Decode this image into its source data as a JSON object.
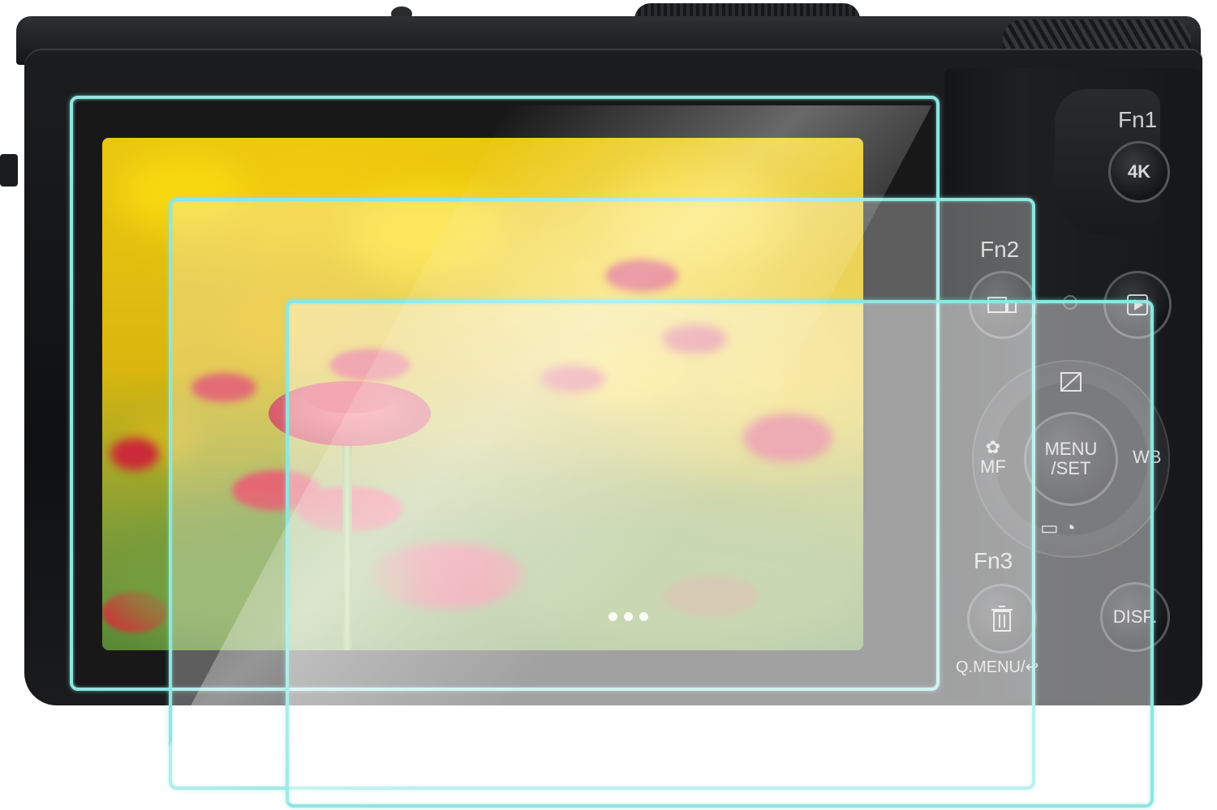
{
  "camera": {
    "buttons": {
      "fn1": "Fn1",
      "fn2": "Fn2",
      "fn3": "Fn3",
      "fourk": "4K",
      "menu_set_line1": "MENU",
      "menu_set_line2": "/SET",
      "mf": "MF",
      "wb": "WB",
      "disp": "DISP.",
      "qmenu": "Q.MENU/"
    },
    "icons": {
      "fourk": "4k-photo-icon",
      "playback": "playback-icon",
      "trash": "trash-icon",
      "return": "return-arrow-icon",
      "exposure": "exposure-compensation-icon",
      "macro": "macro-flower-icon",
      "drive": "drive-mode-self-timer-icon",
      "fn2": "fn2-multi-image-icon"
    }
  },
  "colors": {
    "glass_edge": "#8fe6e0",
    "body": "#141516",
    "flower_red": "#d41a2e",
    "background_yellow": "#f2cc00"
  },
  "product": {
    "protector_count": 3
  }
}
